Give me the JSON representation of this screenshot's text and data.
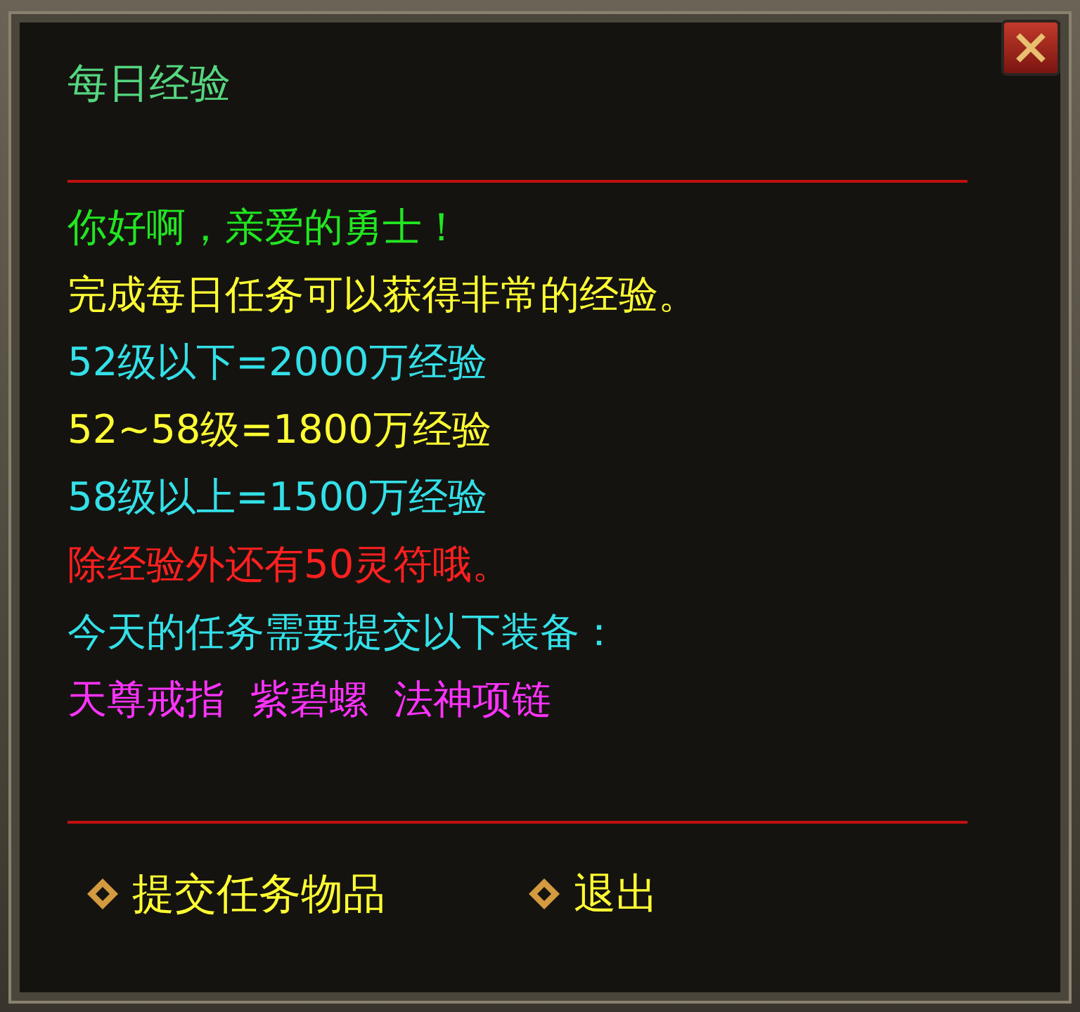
{
  "window": {
    "title": "每日经验"
  },
  "lines": [
    {
      "text": "你好啊，亲爱的勇士！",
      "color": "#22e622"
    },
    {
      "text": "完成每日任务可以获得非常的经验。",
      "color": "#ffff33"
    },
    {
      "text": "52级以下=2000万经验",
      "color": "#33e0e8"
    },
    {
      "text": "52~58级=1800万经验",
      "color": "#ffff33"
    },
    {
      "text": "58级以上=1500万经验",
      "color": "#33e0e8"
    },
    {
      "text": "除经验外还有50灵符哦。",
      "color": "#ff2020"
    },
    {
      "text": "今天的任务需要提交以下装备：",
      "color": "#33e0e8"
    }
  ],
  "items": [
    "天尊戒指",
    "紫碧螺",
    "法神项链"
  ],
  "buttons": [
    "提交任务物品",
    "退出"
  ]
}
